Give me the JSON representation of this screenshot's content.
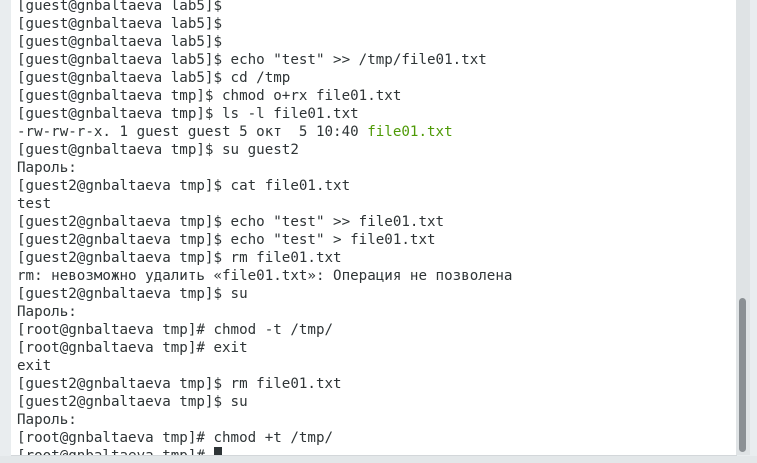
{
  "terminal": {
    "lines": [
      {
        "text": "[guest@gnbaltaeva lab5]$"
      },
      {
        "text": "[guest@gnbaltaeva lab5]$"
      },
      {
        "text": "[guest@gnbaltaeva lab5]$"
      },
      {
        "text": "[guest@gnbaltaeva lab5]$ echo \"test\" >> /tmp/file01.txt"
      },
      {
        "text": "[guest@gnbaltaeva lab5]$ cd /tmp"
      },
      {
        "text": "[guest@gnbaltaeva tmp]$ chmod o+rx file01.txt"
      },
      {
        "text": "[guest@gnbaltaeva tmp]$ ls -l file01.txt"
      },
      {
        "text": "-rw-rw-r-x. 1 guest guest 5 окт  5 10:40 ",
        "highlight": "file01.txt"
      },
      {
        "text": "[guest@gnbaltaeva tmp]$ su guest2"
      },
      {
        "text": "Пароль:"
      },
      {
        "text": "[guest2@gnbaltaeva tmp]$ cat file01.txt"
      },
      {
        "text": "test"
      },
      {
        "text": "[guest2@gnbaltaeva tmp]$ echo \"test\" >> file01.txt"
      },
      {
        "text": "[guest2@gnbaltaeva tmp]$ echo \"test\" > file01.txt"
      },
      {
        "text": "[guest2@gnbaltaeva tmp]$ rm file01.txt"
      },
      {
        "text": "rm: невозможно удалить «file01.txt»: Операция не позволена"
      },
      {
        "text": "[guest2@gnbaltaeva tmp]$ su"
      },
      {
        "text": "Пароль:"
      },
      {
        "text": "[root@gnbaltaeva tmp]# chmod -t /tmp/"
      },
      {
        "text": "[root@gnbaltaeva tmp]# exit"
      },
      {
        "text": "exit"
      },
      {
        "text": "[guest2@gnbaltaeva tmp]$ rm file01.txt"
      },
      {
        "text": "[guest2@gnbaltaeva tmp]$ su"
      },
      {
        "text": "Пароль:"
      },
      {
        "text": "[root@gnbaltaeva tmp]# chmod +t /tmp/"
      },
      {
        "text": "[root@gnbaltaeva tmp]# ",
        "cursor": true
      }
    ]
  },
  "colors": {
    "text": "#2e3436",
    "highlight": "#4e9a06",
    "background": "#ffffff"
  }
}
